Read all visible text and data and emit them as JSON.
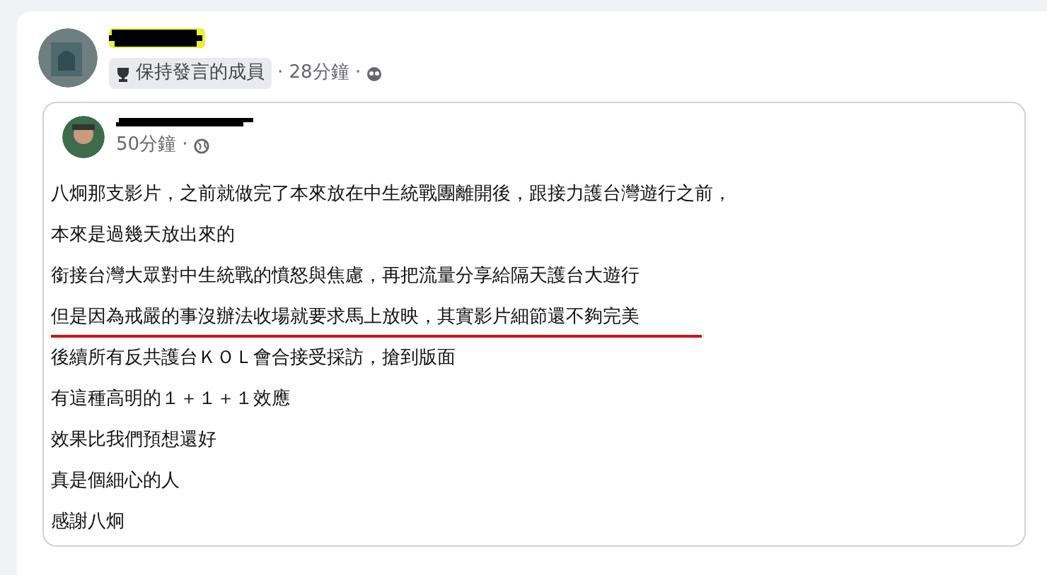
{
  "post": {
    "badge": "保持發言的成員",
    "time": "· 28分鐘 ·"
  },
  "shared_post": {
    "time": "50分鐘 ·",
    "lines": [
      {
        "text": "八炯那支影片，之前就做完了本來放在中生統戰團離開後，跟接力護台灣遊行之前，",
        "underlined": false
      },
      {
        "text": "本來是過幾天放出來的",
        "underlined": false
      },
      {
        "text": "銜接台灣大眾對中生統戰的憤怒與焦慮，再把流量分享給隔天護台大遊行",
        "underlined": false
      },
      {
        "text": "但是因為戒嚴的事沒辦法收場就要求馬上放映，其實影片細節還不夠完美",
        "underlined": true
      },
      {
        "text": "後續所有反共護台ＫＯＬ會合接受採訪，搶到版面",
        "underlined": false
      },
      {
        "text": "有這種高明的１＋１＋１效應",
        "underlined": false
      },
      {
        "text": "效果比我們預想還好",
        "underlined": false
      },
      {
        "text": "真是個細心的人",
        "underlined": false
      },
      {
        "text": "感謝八炯",
        "underlined": false
      }
    ]
  }
}
